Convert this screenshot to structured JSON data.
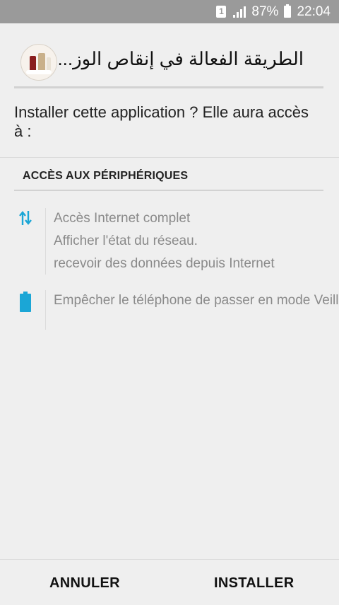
{
  "status_bar": {
    "sim_label": "1",
    "battery_percent": "87%",
    "time": "22:04",
    "background_color": "#9a9a9a"
  },
  "app": {
    "title": "الطريقة الفعالة في إنقاص الوز..."
  },
  "install_prompt": "Installer cette application ? Elle aura accès à :",
  "section": {
    "title": "ACCÈS AUX PÉRIPHÉRIQUES"
  },
  "permissions": {
    "network": {
      "icon": "network-transfer-icon",
      "items": [
        "Accès Internet complet",
        "Afficher l'état du réseau.",
        "recevoir des données depuis Internet"
      ]
    },
    "battery": {
      "icon": "battery-icon",
      "text": "Empêcher le téléphone de passer en mode Veille."
    }
  },
  "buttons": {
    "cancel": "ANNULER",
    "install": "INSTALLER"
  },
  "colors": {
    "accent": "#1ba6d6",
    "background": "#efefef"
  }
}
